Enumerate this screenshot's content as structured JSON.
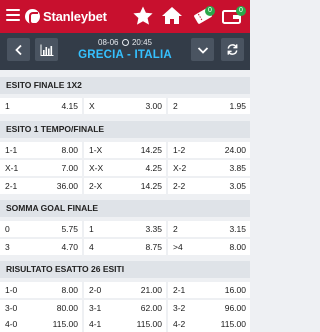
{
  "app": {
    "brand": "Stanleybet"
  },
  "topbar": {
    "icons": [
      "menu-icon",
      "star-icon",
      "home-icon",
      "ticket-icon",
      "wallet-icon"
    ],
    "ticket_badge": "0",
    "wallet_badge": "0",
    "brand_color": "#c8102e",
    "badge_color": "#2aa84a"
  },
  "match": {
    "date": "08-06",
    "time": "20:45",
    "name": "GRECIA - ITALIA",
    "name_color": "#35c1ff"
  },
  "markets": [
    {
      "title": "ESITO FINALE 1X2",
      "rows": [
        [
          {
            "label": "1",
            "odd": "4.15"
          },
          {
            "label": "X",
            "odd": "3.00"
          },
          {
            "label": "2",
            "odd": "1.95"
          }
        ]
      ]
    },
    {
      "title": "ESITO 1 TEMPO/FINALE",
      "rows": [
        [
          {
            "label": "1-1",
            "odd": "8.00"
          },
          {
            "label": "1-X",
            "odd": "14.25"
          },
          {
            "label": "1-2",
            "odd": "24.00"
          }
        ],
        [
          {
            "label": "X-1",
            "odd": "7.00"
          },
          {
            "label": "X-X",
            "odd": "4.25"
          },
          {
            "label": "X-2",
            "odd": "3.85"
          }
        ],
        [
          {
            "label": "2-1",
            "odd": "36.00"
          },
          {
            "label": "2-X",
            "odd": "14.25"
          },
          {
            "label": "2-2",
            "odd": "3.05"
          }
        ]
      ]
    },
    {
      "title": "SOMMA GOAL FINALE",
      "rows": [
        [
          {
            "label": "0",
            "odd": "5.75"
          },
          {
            "label": "1",
            "odd": "3.35"
          },
          {
            "label": "2",
            "odd": "3.15"
          }
        ],
        [
          {
            "label": "3",
            "odd": "4.70"
          },
          {
            "label": "4",
            "odd": "8.75"
          },
          {
            "label": ">4",
            "odd": "8.00"
          }
        ]
      ]
    },
    {
      "title": "RISULTATO ESATTO 26 ESITI",
      "rows": [
        [
          {
            "label": "1-0",
            "odd": "8.00"
          },
          {
            "label": "2-0",
            "odd": "21.00"
          },
          {
            "label": "2-1",
            "odd": "16.00"
          }
        ],
        [
          {
            "label": "3-0",
            "odd": "80.00"
          },
          {
            "label": "3-1",
            "odd": "62.00"
          },
          {
            "label": "3-2",
            "odd": "96.00"
          }
        ],
        [
          {
            "label": "4-0",
            "odd": "115.00"
          },
          {
            "label": "4-1",
            "odd": "115.00"
          },
          {
            "label": "4-2",
            "odd": "115.00"
          }
        ]
      ]
    }
  ]
}
